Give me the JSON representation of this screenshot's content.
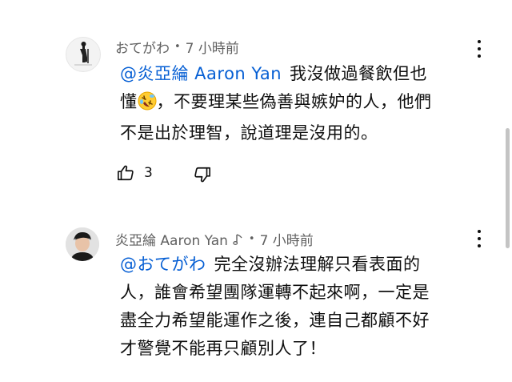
{
  "comments": [
    {
      "author": "おてがわ",
      "separator": "•",
      "time": "7 小時前",
      "mention": "@炎亞綸 Aaron Yan",
      "line1": "我沒做過餐飲但也",
      "line2a": "懂",
      "emoji": "rolling-on-floor-laughing",
      "line2b": "，不要理某些偽善與嫉妒的人，他們",
      "line3": "不是出於理智，說道理是沒用的。",
      "like_count": "3"
    },
    {
      "author": "炎亞綸 Aaron Yan",
      "badge_icon": "music-note-icon",
      "separator": "•",
      "time": "7 小時前",
      "mention": "@おてがわ",
      "line1": "完全沒辦法理解只看表面的",
      "line2": "人，誰會希望團隊運轉不起來啊，一定是",
      "line3": "盡全力希望能運作之後，連自己都顧不好",
      "line4": "才警覺不能再只顧別人了！"
    }
  ],
  "colors": {
    "mention": "#065fd4",
    "meta": "#606060",
    "text": "#0f0f0f"
  }
}
